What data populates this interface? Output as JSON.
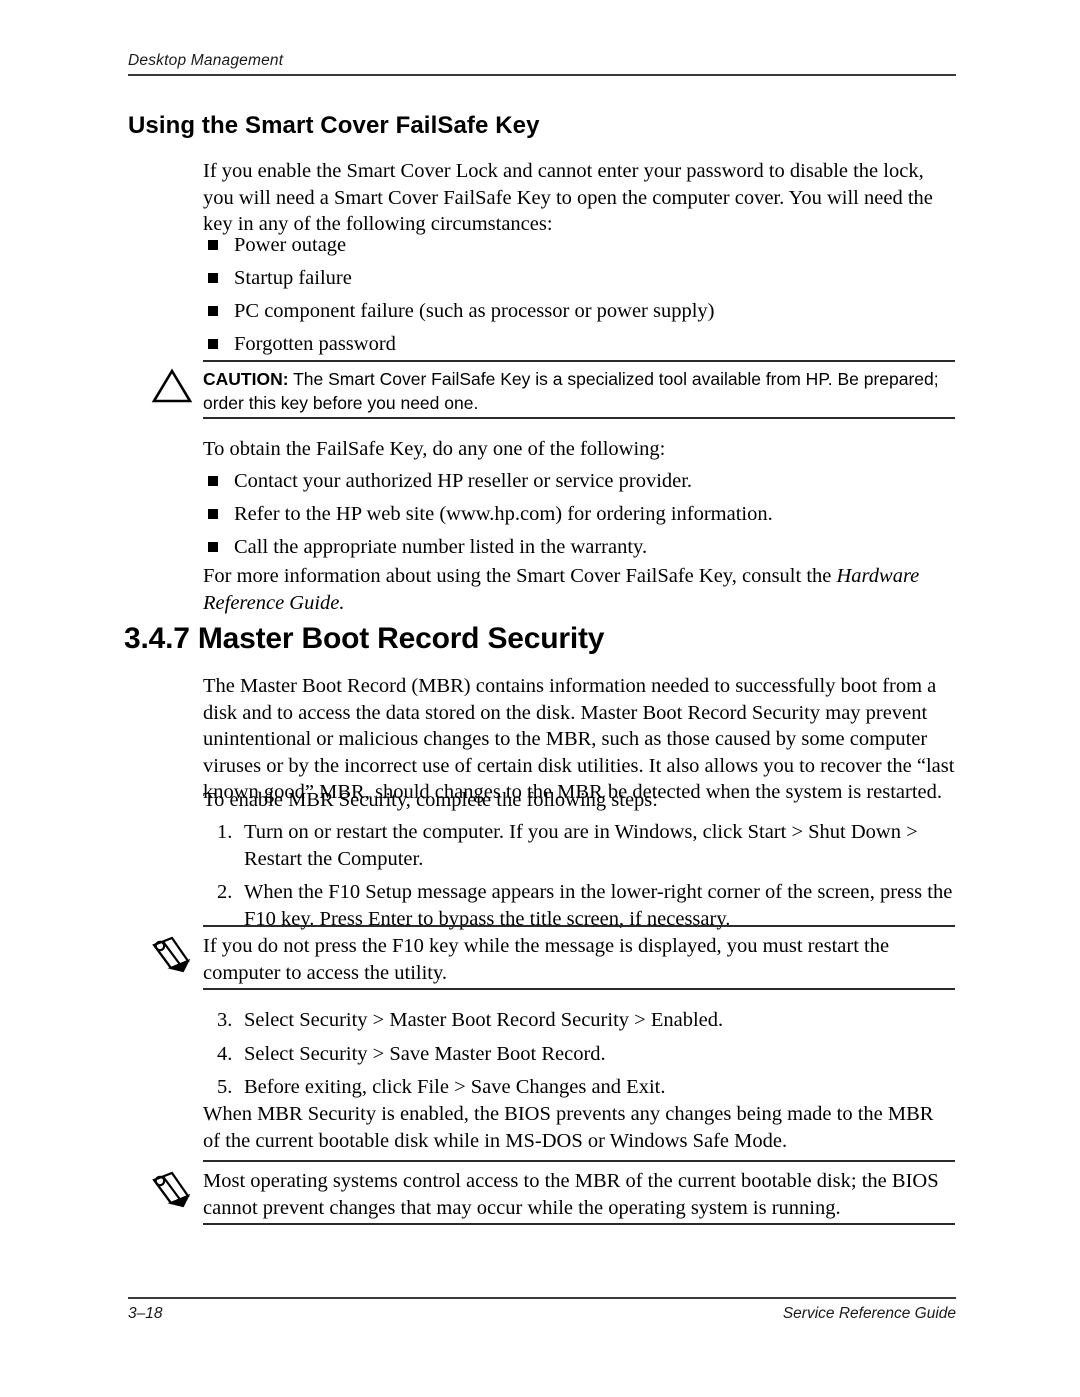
{
  "header": {
    "chapter_title": "Desktop Management"
  },
  "sections": {
    "failsafe": {
      "heading": "Using the Smart Cover FailSafe Key",
      "intro": "If you enable the Smart Cover Lock and cannot enter your password to disable the lock, you will need a Smart Cover FailSafe Key to open the computer cover. You will need the key in any of the following circumstances:",
      "circumstances": [
        "Power outage",
        "Startup failure",
        "PC component failure (such as processor or power supply)",
        "Forgotten password"
      ],
      "caution": {
        "icon": "warning-triangle-icon",
        "label": "CAUTION:",
        "text": " The Smart Cover FailSafe Key is a specialized tool available from HP. Be prepared; order this key before you need one."
      },
      "obtain_intro": "To obtain the FailSafe Key, do any one of the following:",
      "obtain_options": [
        "Contact your authorized HP reseller or service provider.",
        "Refer to the HP web site (www.hp.com) for ordering information.",
        "Call the appropriate number listed in the warranty."
      ],
      "more_info_prefix": "For more information about using the Smart Cover FailSafe Key, consult the ",
      "more_info_italic": "Hardware Reference Guide."
    },
    "mbr": {
      "number": "3.4.7",
      "heading": "3.4.7 Master Boot Record Security",
      "paragraph": "The Master Boot Record (MBR) contains information needed to successfully boot from a disk and to access the data stored on the disk. Master Boot Record Security may prevent unintentional or malicious changes to the MBR, such as those caused by some computer viruses or by the incorrect use of certain disk utilities. It also allows you to recover the “last known good” MBR, should changes to the MBR be detected when the system is restarted.",
      "enable_intro": "To enable MBR Security, complete the following steps:",
      "steps_first": [
        {
          "number": "1.",
          "text": "Turn on or restart the computer. If you are in Windows, click Start > Shut Down > Restart the Computer."
        },
        {
          "number": "2.",
          "text": "When the F10 Setup message appears in the lower-right corner of the screen, press the F10 key. Press Enter to bypass the title screen, if necessary."
        }
      ],
      "note_one": {
        "icon": "pencil-note-icon",
        "text": "If you do not press the F10 key while the message is displayed, you must restart the computer to access the utility."
      },
      "steps_second": [
        {
          "number": "3.",
          "text": "Select Security > Master Boot Record Security > Enabled."
        },
        {
          "number": "4.",
          "text": "Select Security > Save Master Boot Record."
        },
        {
          "number": "5.",
          "text": "Before exiting, click File > Save Changes and Exit."
        }
      ],
      "closing_paragraph": "When MBR Security is enabled, the BIOS prevents any changes being made to the MBR of the current bootable disk while in MS-DOS or Windows Safe Mode.",
      "note_two": {
        "icon": "pencil-note-icon",
        "text": "Most operating systems control access to the MBR of the current bootable disk; the BIOS cannot prevent changes that may occur while the operating system is running."
      }
    }
  },
  "footer": {
    "page_number": "3–18",
    "guide_title": "Service Reference Guide"
  }
}
